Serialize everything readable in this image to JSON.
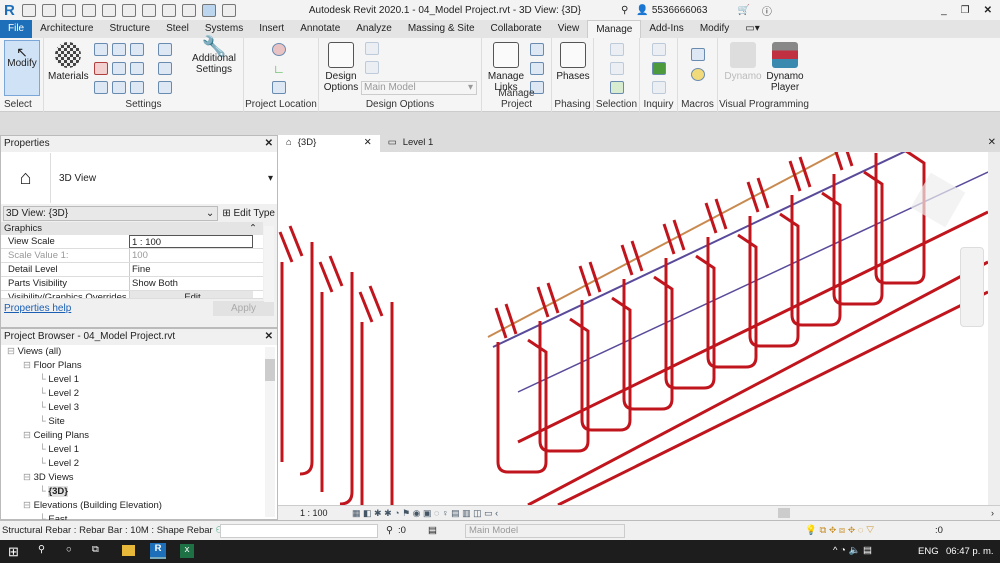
{
  "title": "Autodesk Revit 2020.1 - 04_Model Project.rvt - 3D View: {3D}",
  "user": "5536666063",
  "tabs": [
    "File",
    "Architecture",
    "Structure",
    "Steel",
    "Systems",
    "Insert",
    "Annotate",
    "Analyze",
    "Massing & Site",
    "Collaborate",
    "View",
    "Manage",
    "Add-Ins",
    "Modify"
  ],
  "active_tab": "Manage",
  "ribbon": {
    "modify": "Modify",
    "select": "Select",
    "materials": "Materials",
    "additional_settings": "Additional Settings",
    "settings": "Settings",
    "project_location": "Project Location",
    "design_options_btn": "Design Options",
    "main_model": "Main Model",
    "design_options": "Design Options",
    "manage_links": "Manage Links",
    "manage_project": "Manage Project",
    "phases": "Phases",
    "phasing": "Phasing",
    "selection": "Selection",
    "inquiry": "Inquiry",
    "macros": "Macros",
    "dynamo": "Dynamo",
    "dynamo_player": "Dynamo Player",
    "visual_programming": "Visual Programming"
  },
  "properties": {
    "title": "Properties",
    "type": "3D View",
    "selector": "3D View: {3D}",
    "edit_type": "Edit Type",
    "group": "Graphics",
    "rows": [
      {
        "k": "View Scale",
        "v": "1 : 100"
      },
      {
        "k": "Scale Value    1:",
        "v": "100"
      },
      {
        "k": "Detail Level",
        "v": "Fine"
      },
      {
        "k": "Parts Visibility",
        "v": "Show Both"
      },
      {
        "k": "Visibility/Graphics Overrides",
        "v": "Edit"
      }
    ],
    "help": "Properties help",
    "apply": "Apply"
  },
  "browser": {
    "title": "Project Browser - 04_Model Project.rvt",
    "items": [
      {
        "label": "Views (all)",
        "level": 0
      },
      {
        "label": "Floor Plans",
        "level": 1
      },
      {
        "label": "Level 1",
        "level": 2
      },
      {
        "label": "Level 2",
        "level": 2
      },
      {
        "label": "Level 3",
        "level": 2
      },
      {
        "label": "Site",
        "level": 2
      },
      {
        "label": "Ceiling Plans",
        "level": 1
      },
      {
        "label": "Level 1",
        "level": 2
      },
      {
        "label": "Level 2",
        "level": 2
      },
      {
        "label": "3D Views",
        "level": 1
      },
      {
        "label": "{3D}",
        "level": 2
      },
      {
        "label": "Elevations (Building Elevation)",
        "level": 1
      },
      {
        "label": "East",
        "level": 2
      }
    ]
  },
  "view_tabs": [
    {
      "label": "{3D}",
      "active": true
    },
    {
      "label": "Level 1",
      "active": false
    }
  ],
  "view_scale": "1 : 100",
  "status": {
    "text": "Structural Rebar : Rebar Bar : 10M : Shape Rebar",
    "count": ":0",
    "model": "Main Model",
    "filter": ":0"
  },
  "taskbar": {
    "lang": "ENG",
    "time": "06:47 p. m."
  },
  "colors": {
    "rebar": "#c0151d",
    "file_tab": "#1c6fb8"
  }
}
